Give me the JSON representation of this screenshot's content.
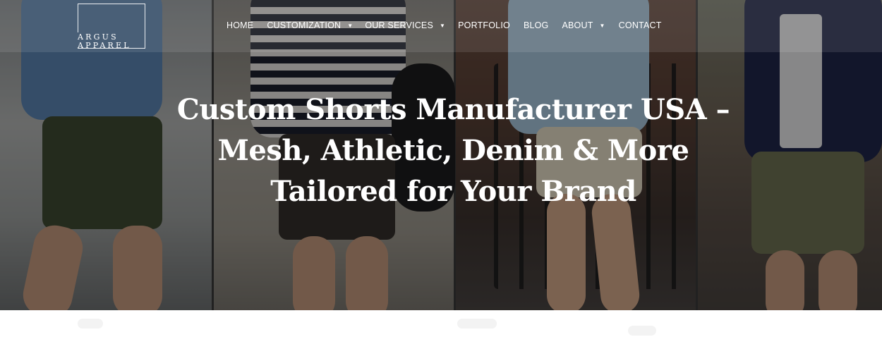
{
  "brand": {
    "line1": "ARGUS",
    "line2": "APPAREL"
  },
  "nav": {
    "items": [
      {
        "label": "HOME",
        "has_dropdown": false
      },
      {
        "label": "CUSTOMIZATION",
        "has_dropdown": true
      },
      {
        "label": "OUR SERVICES",
        "has_dropdown": true
      },
      {
        "label": "PORTFOLIO",
        "has_dropdown": false
      },
      {
        "label": "BLOG",
        "has_dropdown": false
      },
      {
        "label": "ABOUT",
        "has_dropdown": true
      },
      {
        "label": "CONTACT",
        "has_dropdown": false
      }
    ],
    "caret_glyph": "▼"
  },
  "hero": {
    "title": "Custom Shorts Manufacturer USA – Mesh, Athletic, Denim & More Tailored for Your Brand"
  },
  "colors": {
    "overlay": "#000000",
    "text": "#ffffff",
    "page_background": "#ffffff"
  }
}
